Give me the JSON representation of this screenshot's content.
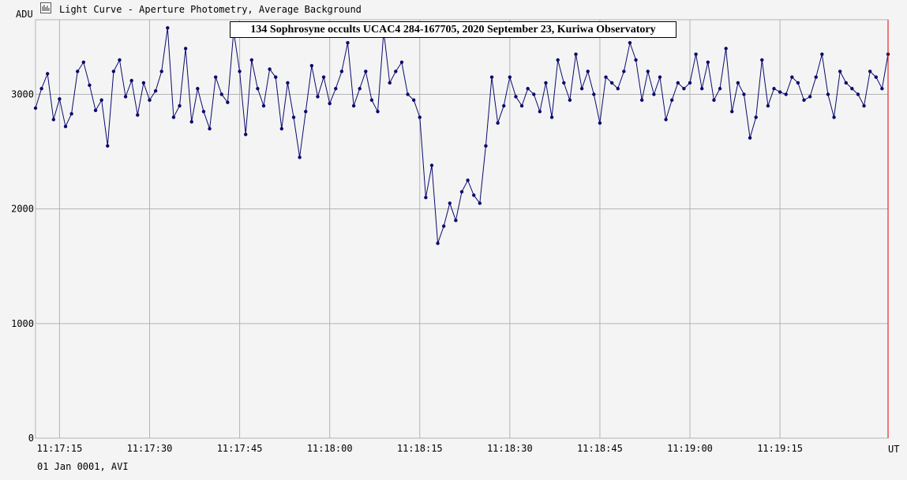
{
  "window": {
    "legend_icon": "chart-icon",
    "legend_label": "Light Curve - Aperture Photometry, Average Background"
  },
  "footer": {
    "date_label": "01 Jan 0001, AVI"
  },
  "colors": {
    "background": "#f4f4f4",
    "grid": "#b4b4b4",
    "series": "#0a0a6e",
    "cursor": "#e00000"
  },
  "chart_data": {
    "type": "line",
    "title": "134 Sophrosyne occults UCAC4 284-167705, 2020 September 23, Kuriwa Observatory",
    "ylabel": "ADU",
    "xlabel": "UT",
    "ylim": [
      0,
      3000
    ],
    "yticks": [
      0,
      1000,
      2000,
      3000
    ],
    "xlim": [
      "11:17:11",
      "11:19:33"
    ],
    "xticks": [
      "11:17:15",
      "11:17:30",
      "11:17:45",
      "11:18:00",
      "11:18:15",
      "11:18:30",
      "11:18:45",
      "11:19:00",
      "11:19:15"
    ],
    "grid": true,
    "cursor_x": "11:19:33",
    "series": [
      {
        "x": [
          "11:17:11",
          "11:17:12",
          "11:17:13",
          "11:17:14",
          "11:17:15",
          "11:17:16",
          "11:17:17",
          "11:17:18",
          "11:17:19",
          "11:17:20",
          "11:17:21",
          "11:17:22",
          "11:17:23",
          "11:17:24",
          "11:17:25",
          "11:17:26",
          "11:17:27",
          "11:17:28",
          "11:17:29",
          "11:17:30",
          "11:17:31",
          "11:17:32",
          "11:17:33",
          "11:17:34",
          "11:17:35",
          "11:17:36",
          "11:17:37",
          "11:17:38",
          "11:17:39",
          "11:17:40",
          "11:17:41",
          "11:17:42",
          "11:17:43",
          "11:17:44",
          "11:17:45",
          "11:17:46",
          "11:17:47",
          "11:17:48",
          "11:17:49",
          "11:17:50",
          "11:17:51",
          "11:17:52",
          "11:17:53",
          "11:17:54",
          "11:17:55",
          "11:17:56",
          "11:17:57",
          "11:17:58",
          "11:17:59",
          "11:18:00",
          "11:18:01",
          "11:18:02",
          "11:18:03",
          "11:18:04",
          "11:18:05",
          "11:18:06",
          "11:18:07",
          "11:18:08",
          "11:18:09",
          "11:18:10",
          "11:18:11",
          "11:18:12",
          "11:18:13",
          "11:18:14",
          "11:18:15",
          "11:18:16",
          "11:18:17",
          "11:18:18",
          "11:18:19",
          "11:18:20",
          "11:18:21",
          "11:18:22",
          "11:18:23",
          "11:18:24",
          "11:18:25",
          "11:18:26",
          "11:18:27",
          "11:18:28",
          "11:18:29",
          "11:18:30",
          "11:18:31",
          "11:18:32",
          "11:18:33",
          "11:18:34",
          "11:18:35",
          "11:18:36",
          "11:18:37",
          "11:18:38",
          "11:18:39",
          "11:18:40",
          "11:18:41",
          "11:18:42",
          "11:18:43",
          "11:18:44",
          "11:18:45",
          "11:18:46",
          "11:18:47",
          "11:18:48",
          "11:18:49",
          "11:18:50",
          "11:18:51",
          "11:18:52",
          "11:18:53",
          "11:18:54",
          "11:18:55",
          "11:18:56",
          "11:18:57",
          "11:18:58",
          "11:18:59",
          "11:19:00",
          "11:19:01",
          "11:19:02",
          "11:19:03",
          "11:19:04",
          "11:19:05",
          "11:19:06",
          "11:19:07",
          "11:19:08",
          "11:19:09",
          "11:19:10",
          "11:19:11",
          "11:19:12",
          "11:19:13",
          "11:19:14",
          "11:19:15",
          "11:19:16",
          "11:19:17",
          "11:19:18",
          "11:19:19",
          "11:19:20",
          "11:19:21",
          "11:19:22",
          "11:19:23",
          "11:19:24",
          "11:19:25",
          "11:19:26",
          "11:19:27",
          "11:19:28",
          "11:19:29",
          "11:19:30",
          "11:19:31",
          "11:19:32",
          "11:19:33"
        ],
        "values": [
          2880,
          3050,
          3180,
          2780,
          2960,
          2720,
          2830,
          3200,
          3280,
          3080,
          2860,
          2950,
          2550,
          3200,
          3300,
          2980,
          3120,
          2820,
          3100,
          2950,
          3030,
          3200,
          3580,
          2800,
          2900,
          3400,
          2760,
          3050,
          2850,
          2700,
          3150,
          3000,
          2930,
          3550,
          3200,
          2650,
          3300,
          3050,
          2900,
          3220,
          3150,
          2700,
          3100,
          2800,
          2450,
          2850,
          3250,
          2980,
          3150,
          2920,
          3050,
          3200,
          3450,
          2900,
          3050,
          3200,
          2950,
          2850,
          3550,
          3100,
          3200,
          3280,
          3000,
          2950,
          2800,
          2100,
          2380,
          1700,
          1850,
          2050,
          1900,
          2150,
          2250,
          2120,
          2050,
          2550,
          3150,
          2750,
          2900,
          3150,
          2980,
          2900,
          3050,
          3000,
          2850,
          3100,
          2800,
          3300,
          3100,
          2950,
          3350,
          3050,
          3200,
          3000,
          2750,
          3150,
          3100,
          3050,
          3200,
          3450,
          3300,
          2950,
          3200,
          3000,
          3150,
          2780,
          2950,
          3100,
          3050,
          3100,
          3350,
          3050,
          3280,
          2950,
          3050,
          3400,
          2850,
          3100,
          3000,
          2620,
          2800,
          3300,
          2900,
          3050,
          3020,
          3000,
          3150,
          3100,
          2950,
          2980,
          3150,
          3350,
          3000,
          2800,
          3200,
          3100,
          3050,
          3000,
          2900,
          3200,
          3150,
          3050,
          3350
        ]
      }
    ]
  }
}
